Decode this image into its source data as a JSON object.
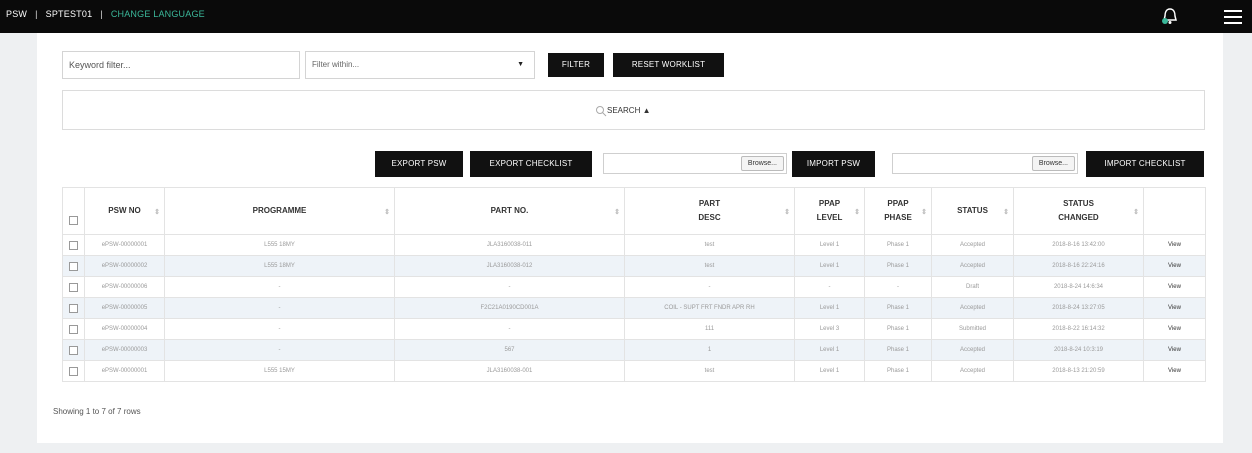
{
  "topbar": {
    "app": "PSW",
    "user": "SPTEST01",
    "language_link": "CHANGE LANGUAGE",
    "icons": {
      "bell": "bell-icon",
      "menu": "hamburger-menu-icon"
    }
  },
  "filters": {
    "keyword_placeholder": "Keyword filter...",
    "filter_within": "Filter within...",
    "filter_button": "FILTER",
    "reset_button": "RESET WORKLIST"
  },
  "search": {
    "label": "SEARCH ▲",
    "icon": "magnifier-icon"
  },
  "actions": {
    "export_psw": "EXPORT PSW",
    "export_checklist": "EXPORT CHECKLIST",
    "browse": "Browse...",
    "import_psw": "IMPORT PSW",
    "import_checklist": "IMPORT CHECKLIST"
  },
  "table": {
    "columns": [
      "PSW NO",
      "PROGRAMME",
      "PART NO.",
      "PART DESC",
      "PPAP LEVEL",
      "PPAP PHASE",
      "STATUS",
      "STATUS CHANGED"
    ],
    "rows": [
      [
        "ePSW-00000001",
        "L555 18MY",
        "JLA3160038-011",
        "test",
        "Level 1",
        "Phase 1",
        "Accepted",
        "2018-8-16 13:42:00",
        "View"
      ],
      [
        "ePSW-00000002",
        "L555 18MY",
        "JLA3160038-012",
        "test",
        "Level 1",
        "Phase 1",
        "Accepted",
        "2018-8-16 22:24:16",
        "View"
      ],
      [
        "ePSW-00000006",
        "-",
        "-",
        "-",
        "-",
        "-",
        "Draft",
        "2018-8-24 14:6:34",
        "View"
      ],
      [
        "ePSW-00000005",
        "-",
        "F2C21A0190CD001A",
        "COIL - SUPT FRT FNDR APR RH",
        "Level 1",
        "Phase 1",
        "Accepted",
        "2018-8-24 13:27:05",
        "View"
      ],
      [
        "ePSW-00000004",
        "-",
        "-",
        "111",
        "Level 3",
        "Phase 1",
        "Submitted",
        "2018-8-22 16:14:32",
        "View"
      ],
      [
        "ePSW-00000003",
        "-",
        "567",
        "1",
        "Level 1",
        "Phase 1",
        "Accepted",
        "2018-8-24 10:3:19",
        "View"
      ],
      [
        "ePSW-00000001",
        "L555 15MY",
        "JLA3160038-001",
        "test",
        "Level 1",
        "Phase 1",
        "Accepted",
        "2018-8-13 21:20:59",
        "View"
      ]
    ]
  },
  "footer": {
    "summary": "Showing 1 to 7 of 7 rows"
  }
}
